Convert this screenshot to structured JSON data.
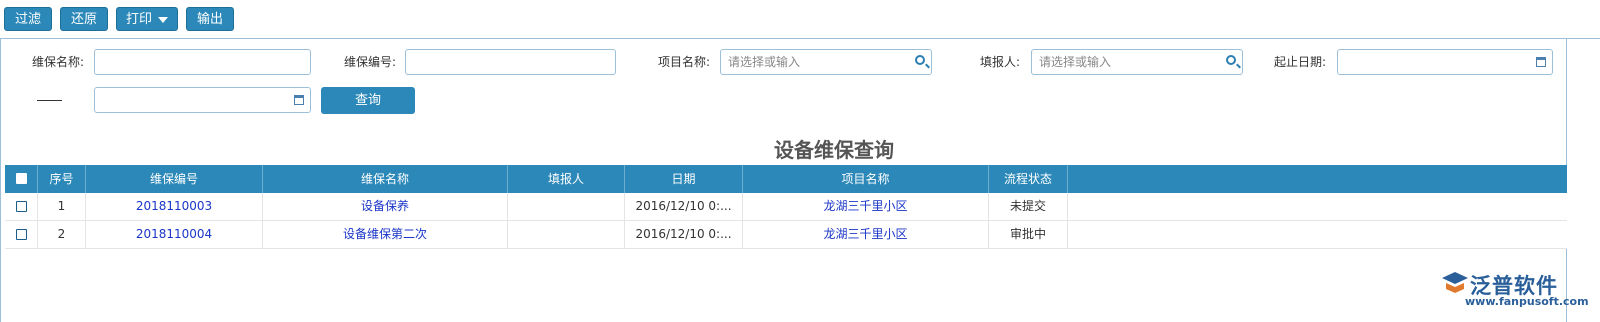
{
  "toolbar": {
    "filter_label": "过滤",
    "restore_label": "还原",
    "print_label": "打印",
    "output_label": "输出"
  },
  "form": {
    "maint_name_label": "维保名称:",
    "maint_no_label": "维保编号:",
    "project_name_label": "项目名称:",
    "project_name_placeholder": "请选择或输入",
    "filler_label": "填报人:",
    "filler_placeholder": "请选择或输入",
    "date_range_label": "起止日期:",
    "range_separator": "——",
    "query_label": "查询"
  },
  "page_title": "设备维保查询",
  "table": {
    "headers": {
      "index": "序号",
      "maint_no": "维保编号",
      "maint_name": "维保名称",
      "filler": "填报人",
      "date": "日期",
      "project": "项目名称",
      "status": "流程状态"
    },
    "rows": [
      {
        "index": "1",
        "maint_no": "2018110003",
        "maint_name": "设备保养",
        "filler": "",
        "date": "2016/12/10 0:...",
        "project": "龙湖三千里小区",
        "status": "未提交"
      },
      {
        "index": "2",
        "maint_no": "2018110004",
        "maint_name": "设备维保第二次",
        "filler": "",
        "date": "2016/12/10 0:...",
        "project": "龙湖三千里小区",
        "status": "审批中"
      }
    ]
  },
  "logo": {
    "name": "泛普软件",
    "url": "www.fanpusoft.com"
  },
  "colors": {
    "accent": "#2b88b8",
    "link": "#1a35c8",
    "logo": "#2a5f9a"
  }
}
